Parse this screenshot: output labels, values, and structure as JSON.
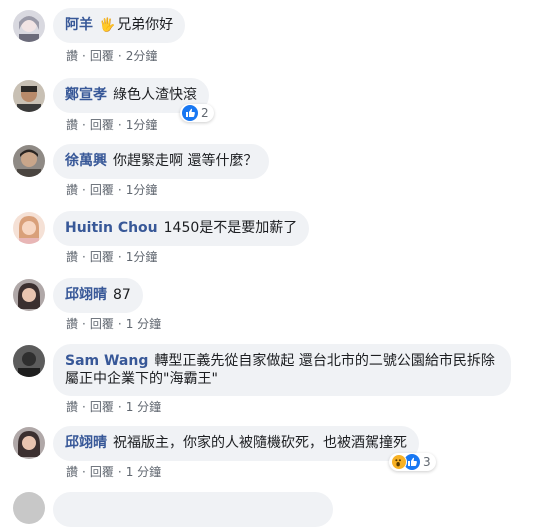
{
  "comments": [
    {
      "author": "阿羊",
      "text": "兄弟你好",
      "emoji": "🖐",
      "actions": [
        "讚",
        "回覆",
        "2分鐘"
      ]
    },
    {
      "author": "鄭宣孝",
      "text": "綠色人渣快滾",
      "actions": [
        "讚",
        "回覆",
        "1分鐘"
      ],
      "reaction_count": "2"
    },
    {
      "author": "徐萬興",
      "text": "你趕緊走啊 還等什麼？",
      "actions": [
        "讚",
        "回覆",
        "1分鐘"
      ]
    },
    {
      "author": "Huitin Chou",
      "text": "1450是不是要加薪了",
      "actions": [
        "讚",
        "回覆",
        "1分鐘"
      ]
    },
    {
      "author": "邱翊晴",
      "text": "87",
      "actions": [
        "讚",
        "回覆",
        "1 分鐘"
      ]
    },
    {
      "author": "Sam Wang",
      "text": "轉型正義先從自家做起 還台北市的二號公園給市民拆除屬正中企業下的\"海霸王\"",
      "actions": [
        "讚",
        "回覆",
        "1 分鐘"
      ]
    },
    {
      "author": "邱翊晴",
      "text": "祝福版主，你家的人被隨機砍死，也被酒駕撞死",
      "actions": [
        "讚",
        "回覆",
        "1 分鐘"
      ],
      "reaction_count": "3"
    }
  ],
  "colors": {
    "author": "#385898",
    "bubble": "#f0f2f5",
    "meta": "#606770",
    "like": "#1877f2"
  }
}
